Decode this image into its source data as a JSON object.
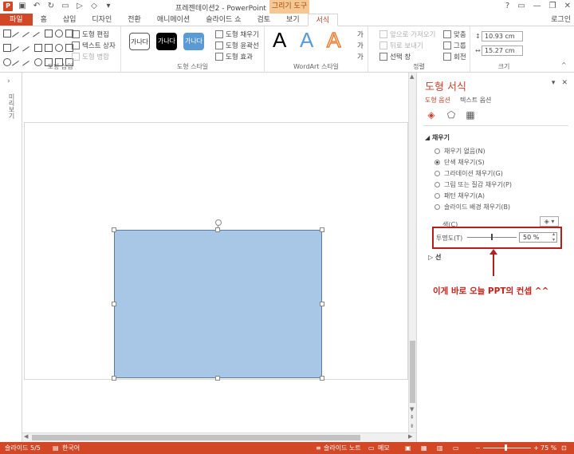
{
  "window": {
    "title": "프레젠테이션2 - PowerPoint",
    "context_tab_header": "그리기 도구",
    "signin": "로그인"
  },
  "tabs": [
    {
      "label": "파일",
      "kind": "file"
    },
    {
      "label": "홈",
      "kind": "normal"
    },
    {
      "label": "삽입",
      "kind": "normal"
    },
    {
      "label": "디자인",
      "kind": "normal"
    },
    {
      "label": "전환",
      "kind": "normal"
    },
    {
      "label": "애니메이션",
      "kind": "normal"
    },
    {
      "label": "슬라이드 쇼",
      "kind": "normal"
    },
    {
      "label": "검토",
      "kind": "normal"
    },
    {
      "label": "보기",
      "kind": "normal"
    },
    {
      "label": "서식",
      "kind": "active"
    }
  ],
  "ribbon": {
    "insert_shapes": {
      "label": "도형 삽입",
      "edit_shape": "도형 편집",
      "text_box": "텍스트 상자",
      "merge_shapes": "도형 병합"
    },
    "shape_styles": {
      "label": "도형 스타일",
      "swatch_text": "가나다",
      "fill": "도형 채우기",
      "outline": "도형 윤곽선",
      "effects": "도형 효과"
    },
    "wordart": {
      "label": "WordArt 스타일",
      "letter": "A"
    },
    "arrange": {
      "label": "정렬",
      "bring_forward": "앞으로 가져오기",
      "send_backward": "뒤로 보내기",
      "selection_pane": "선택 창",
      "align": "맞춤",
      "group": "그룹",
      "rotate": "회전"
    },
    "size": {
      "label": "크기",
      "height": "10.93 cm",
      "width": "15.27 cm"
    }
  },
  "thumbstrip": {
    "label": "미리보기"
  },
  "pane": {
    "title": "도형 서식",
    "tabs": [
      "도형 옵션",
      "텍스트 옵션"
    ],
    "fill_section": "채우기",
    "fill_options": [
      {
        "label": "채우기 없음(N)",
        "selected": false
      },
      {
        "label": "단색 채우기(S)",
        "selected": true
      },
      {
        "label": "그라데이션 채우기(G)",
        "selected": false
      },
      {
        "label": "그림 또는 질감 채우기(P)",
        "selected": false
      },
      {
        "label": "패턴 채우기(A)",
        "selected": false
      },
      {
        "label": "슬라이드 배경 채우기(B)",
        "selected": false
      }
    ],
    "color_label": "색(C)",
    "transparency_label": "투명도(T)",
    "transparency_value": "50 %",
    "transparency_fraction": 0.5,
    "line_section": "선",
    "annotation": "이게 바로 오늘 PPT의 컨셉 ^^"
  },
  "shape": {
    "fill_color": "#a8c6e6",
    "border_color": "#5a7aa0"
  },
  "status": {
    "slide": "슬라이드 5/5",
    "language": "한국어",
    "notes": "슬라이드 노트",
    "comments": "메모",
    "zoom": "75 %"
  },
  "colors": {
    "accent": "#d24726",
    "pane_title": "#c4432b",
    "highlight_box": "#b81e1e"
  }
}
